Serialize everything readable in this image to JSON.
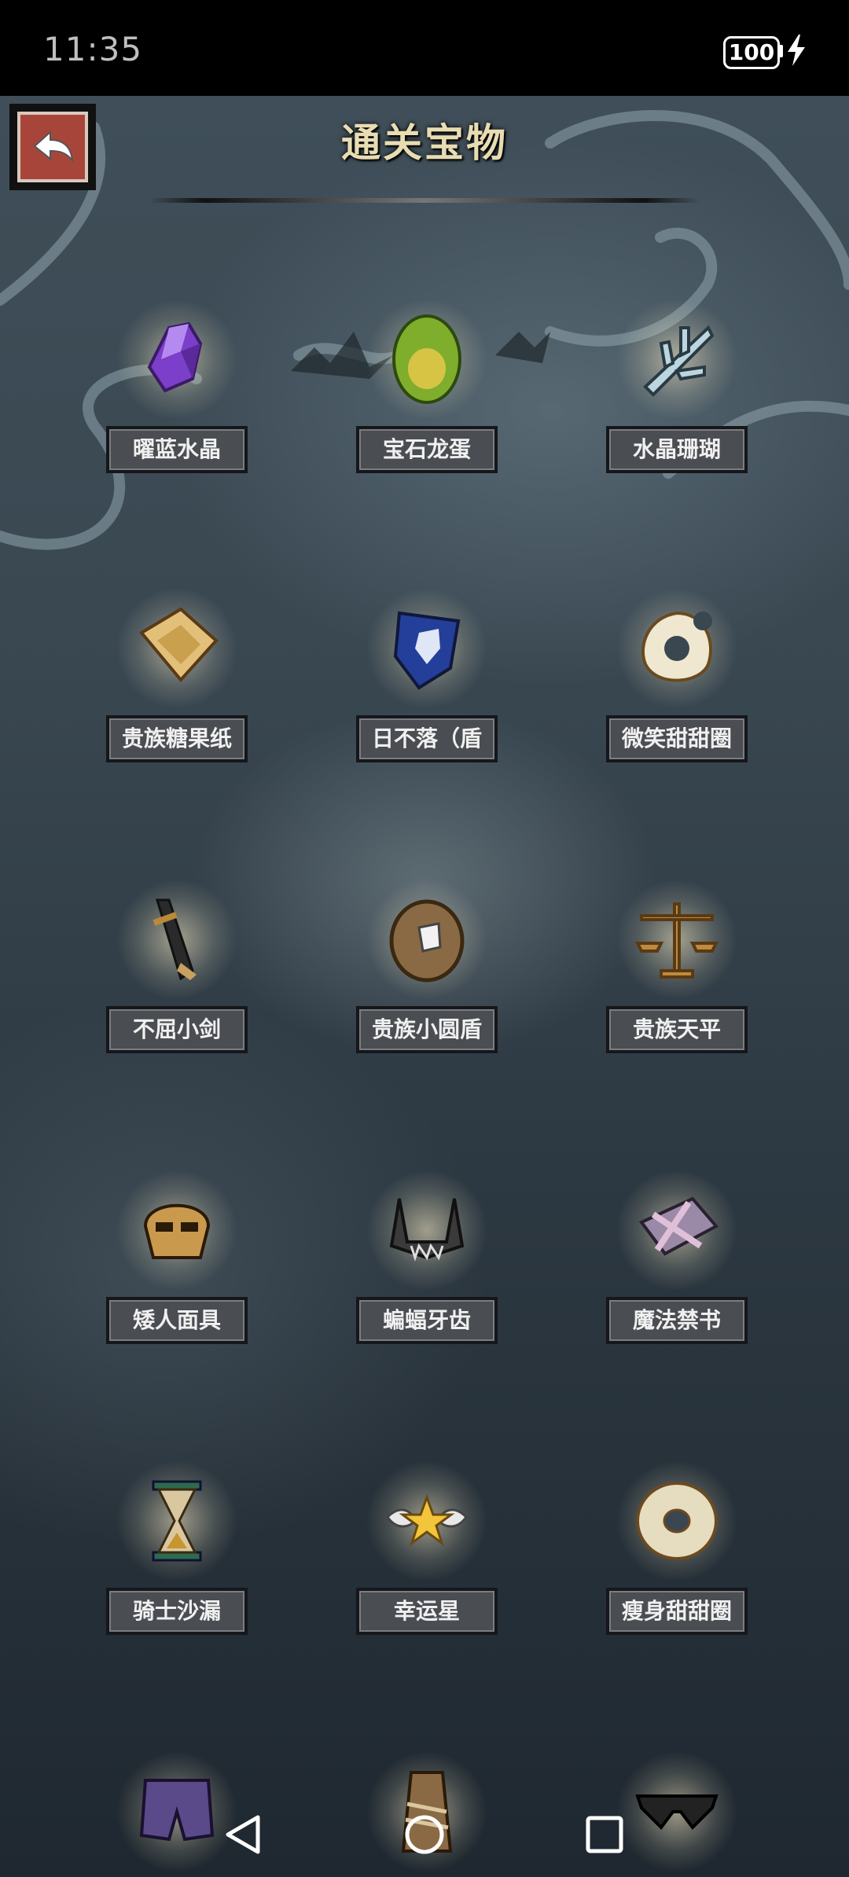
{
  "status": {
    "time": "11:35",
    "battery": "100"
  },
  "header": {
    "title": "通关宝物"
  },
  "items": [
    {
      "label": "曜蓝水晶",
      "icon": "purple-crystal-icon"
    },
    {
      "label": "宝石龙蛋",
      "icon": "green-egg-icon"
    },
    {
      "label": "水晶珊瑚",
      "icon": "crystal-coral-icon"
    },
    {
      "label": "贵族糖果纸",
      "icon": "candy-wrapper-icon"
    },
    {
      "label": "日不落（盾",
      "icon": "blue-shield-icon"
    },
    {
      "label": "微笑甜甜圈",
      "icon": "bitten-donut-icon"
    },
    {
      "label": "不屈小剑",
      "icon": "short-sword-icon"
    },
    {
      "label": "贵族小圆盾",
      "icon": "round-shield-icon"
    },
    {
      "label": "贵族天平",
      "icon": "balance-scale-icon"
    },
    {
      "label": "矮人面具",
      "icon": "dwarf-mask-icon"
    },
    {
      "label": "蝙蝠牙齿",
      "icon": "bat-teeth-icon"
    },
    {
      "label": "魔法禁书",
      "icon": "forbidden-book-icon"
    },
    {
      "label": "骑士沙漏",
      "icon": "hourglass-icon"
    },
    {
      "label": "幸运星",
      "icon": "winged-star-icon"
    },
    {
      "label": "瘦身甜甜圈",
      "icon": "donut-icon"
    },
    {
      "label": "",
      "icon": "shorts-icon"
    },
    {
      "label": "",
      "icon": "bandage-icon"
    },
    {
      "label": "",
      "icon": "sunglasses-icon"
    }
  ]
}
